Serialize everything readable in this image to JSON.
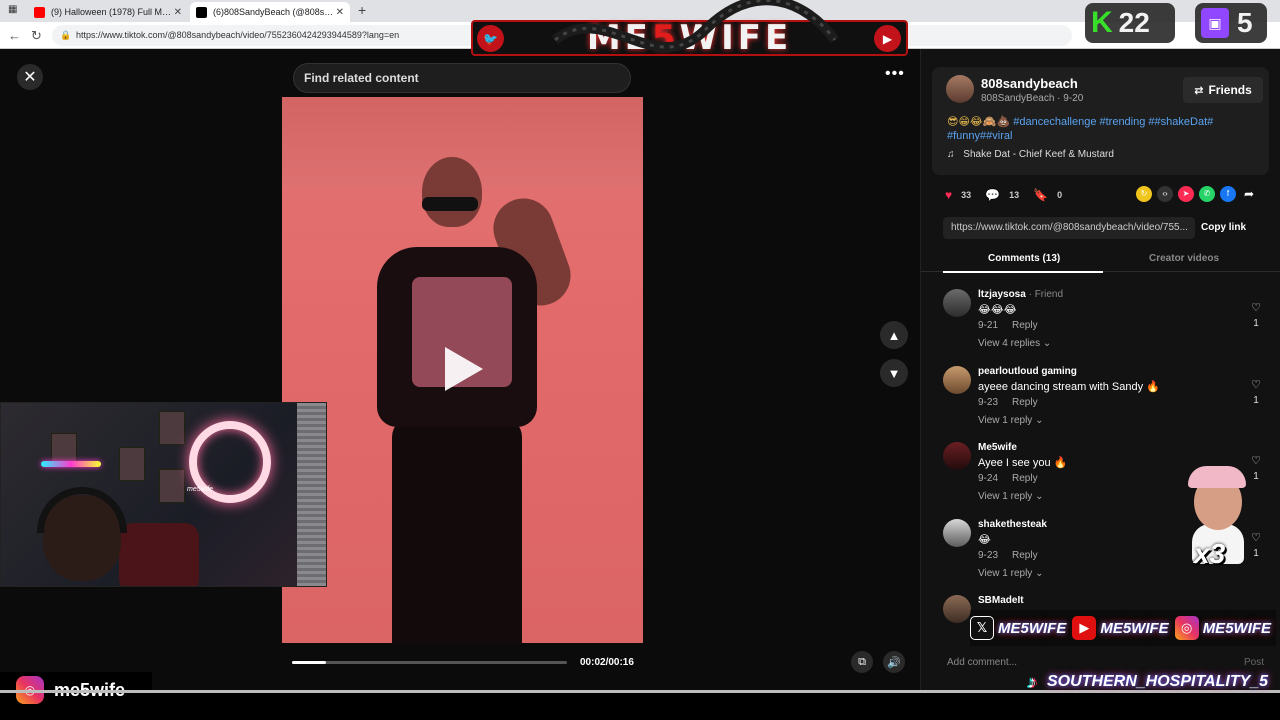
{
  "browser": {
    "tabs": [
      {
        "title": "(9) Halloween (1978) Full Movie -",
        "favicon_color": "#ff0000"
      },
      {
        "title": "(6)808SandyBeach (@808sandyb",
        "favicon_color": "#000000"
      }
    ],
    "url": "https://www.tiktok.com/@808sandybeach/video/7552360424293944589?lang=en"
  },
  "player": {
    "search_placeholder": "Find related content",
    "time": "00:02/00:16",
    "progress_fraction": 0.125
  },
  "post": {
    "username": "808sandybeach",
    "subtitle": "808SandyBeach · 9-20",
    "friends_label": "Friends",
    "emojis": "😎😁😂🙈💩",
    "hashtags": "#dancechallenge #trending ##shakeDat# #funny##viral",
    "music": "Shake Dat - Chief Keef & Mustard",
    "likes": "33",
    "comments_count": "13",
    "saves": "0",
    "link": "https://www.tiktok.com/@808sandybeach/video/755...",
    "copy_link": "Copy link",
    "tab_comments": "Comments (13)",
    "tab_creator": "Creator videos",
    "add_comment": "Add comment...",
    "post_label": "Post"
  },
  "comments": [
    {
      "name": "ltzjaysosa",
      "friend": " · Friend",
      "text": "😂😂😂",
      "date": "9-21",
      "reply": "Reply",
      "replies": "View 4 replies ⌄",
      "likes": "1"
    },
    {
      "name": "pearloutloud gaming",
      "friend": "",
      "text": "ayeee dancing stream with Sandy 🔥",
      "date": "9-23",
      "reply": "Reply",
      "replies": "View 1 reply ⌄",
      "likes": "1"
    },
    {
      "name": "Me5wife",
      "friend": "",
      "text": "Ayee I see you 🔥",
      "date": "9-24",
      "reply": "Reply",
      "replies": "View 1 reply ⌄",
      "likes": "1"
    },
    {
      "name": "shakethesteak",
      "friend": "",
      "text": "😂",
      "date": "9-23",
      "reply": "Reply",
      "replies": "View 1 reply ⌄",
      "likes": "1"
    },
    {
      "name": "SBMadeIt",
      "friend": "",
      "text": "",
      "date": "",
      "reply": "",
      "replies": "",
      "likes": ""
    }
  ],
  "overlay": {
    "logo_pre": "ME",
    "logo_five": "5",
    "logo_post": "WIFE",
    "kick_letter": "K",
    "kick_count": "22",
    "twitch_count": "5",
    "webcam_tag": "me5wife",
    "instagram_handle": "me5wife",
    "socials": [
      {
        "platform": "X",
        "handle": "ME5WIFE",
        "color": "#111111"
      },
      {
        "platform": "YouTube",
        "handle": "ME5WIFE",
        "color": "#e01010"
      },
      {
        "platform": "Instagram",
        "handle": "ME5WIFE",
        "color": "#c2318a"
      }
    ],
    "tiktok_handle": "SOUTHERN_HOSPITALITY_5",
    "sticker_multiplier": "x3"
  }
}
